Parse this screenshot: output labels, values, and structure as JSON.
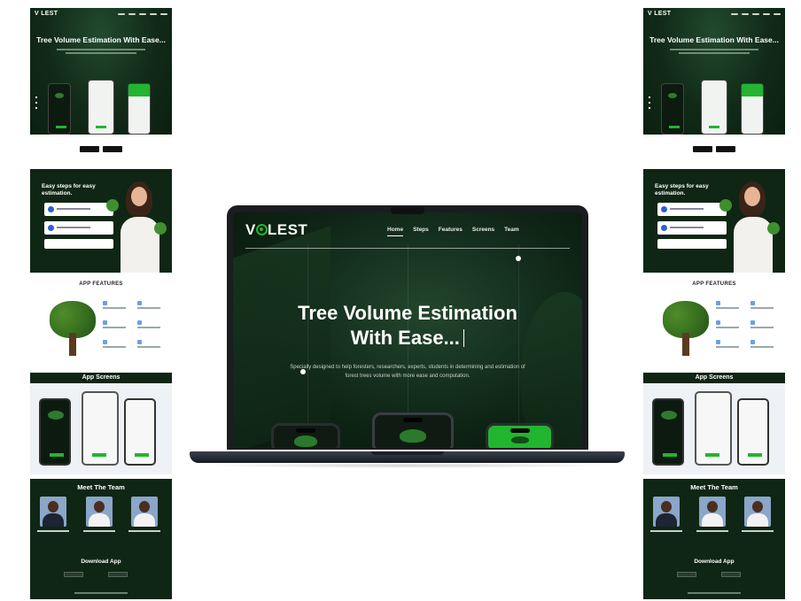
{
  "laptop_site": {
    "logo": {
      "pre": "V",
      "post": "LEST"
    },
    "nav": [
      {
        "label": "Home",
        "active": true
      },
      {
        "label": "Steps",
        "active": false
      },
      {
        "label": "Features",
        "active": false
      },
      {
        "label": "Screens",
        "active": false
      },
      {
        "label": "Team",
        "active": false
      }
    ],
    "hero": {
      "title_line1": "Tree Volume Estimation",
      "title_line2": "With Ease...",
      "subtitle": "Specially designed to help foresters, researchers, experts, students in determining and estimation of forest trees volume with more ease and computation."
    }
  },
  "previews": {
    "logo": "V   LEST",
    "hero_title": "Tree Volume Estimation With Ease...",
    "steps_title": "Easy steps for easy estimation.",
    "features_title": "APP FEATURES",
    "screens_title": "App Screens",
    "team_title": "Meet The Team",
    "download_title": "Download App"
  },
  "colors": {
    "brand_green": "#22b52f",
    "dark_green": "#0f2614",
    "laptop_body": "#242a33"
  },
  "icons": [
    "logo-ring-icon",
    "typing-cursor-icon"
  ]
}
